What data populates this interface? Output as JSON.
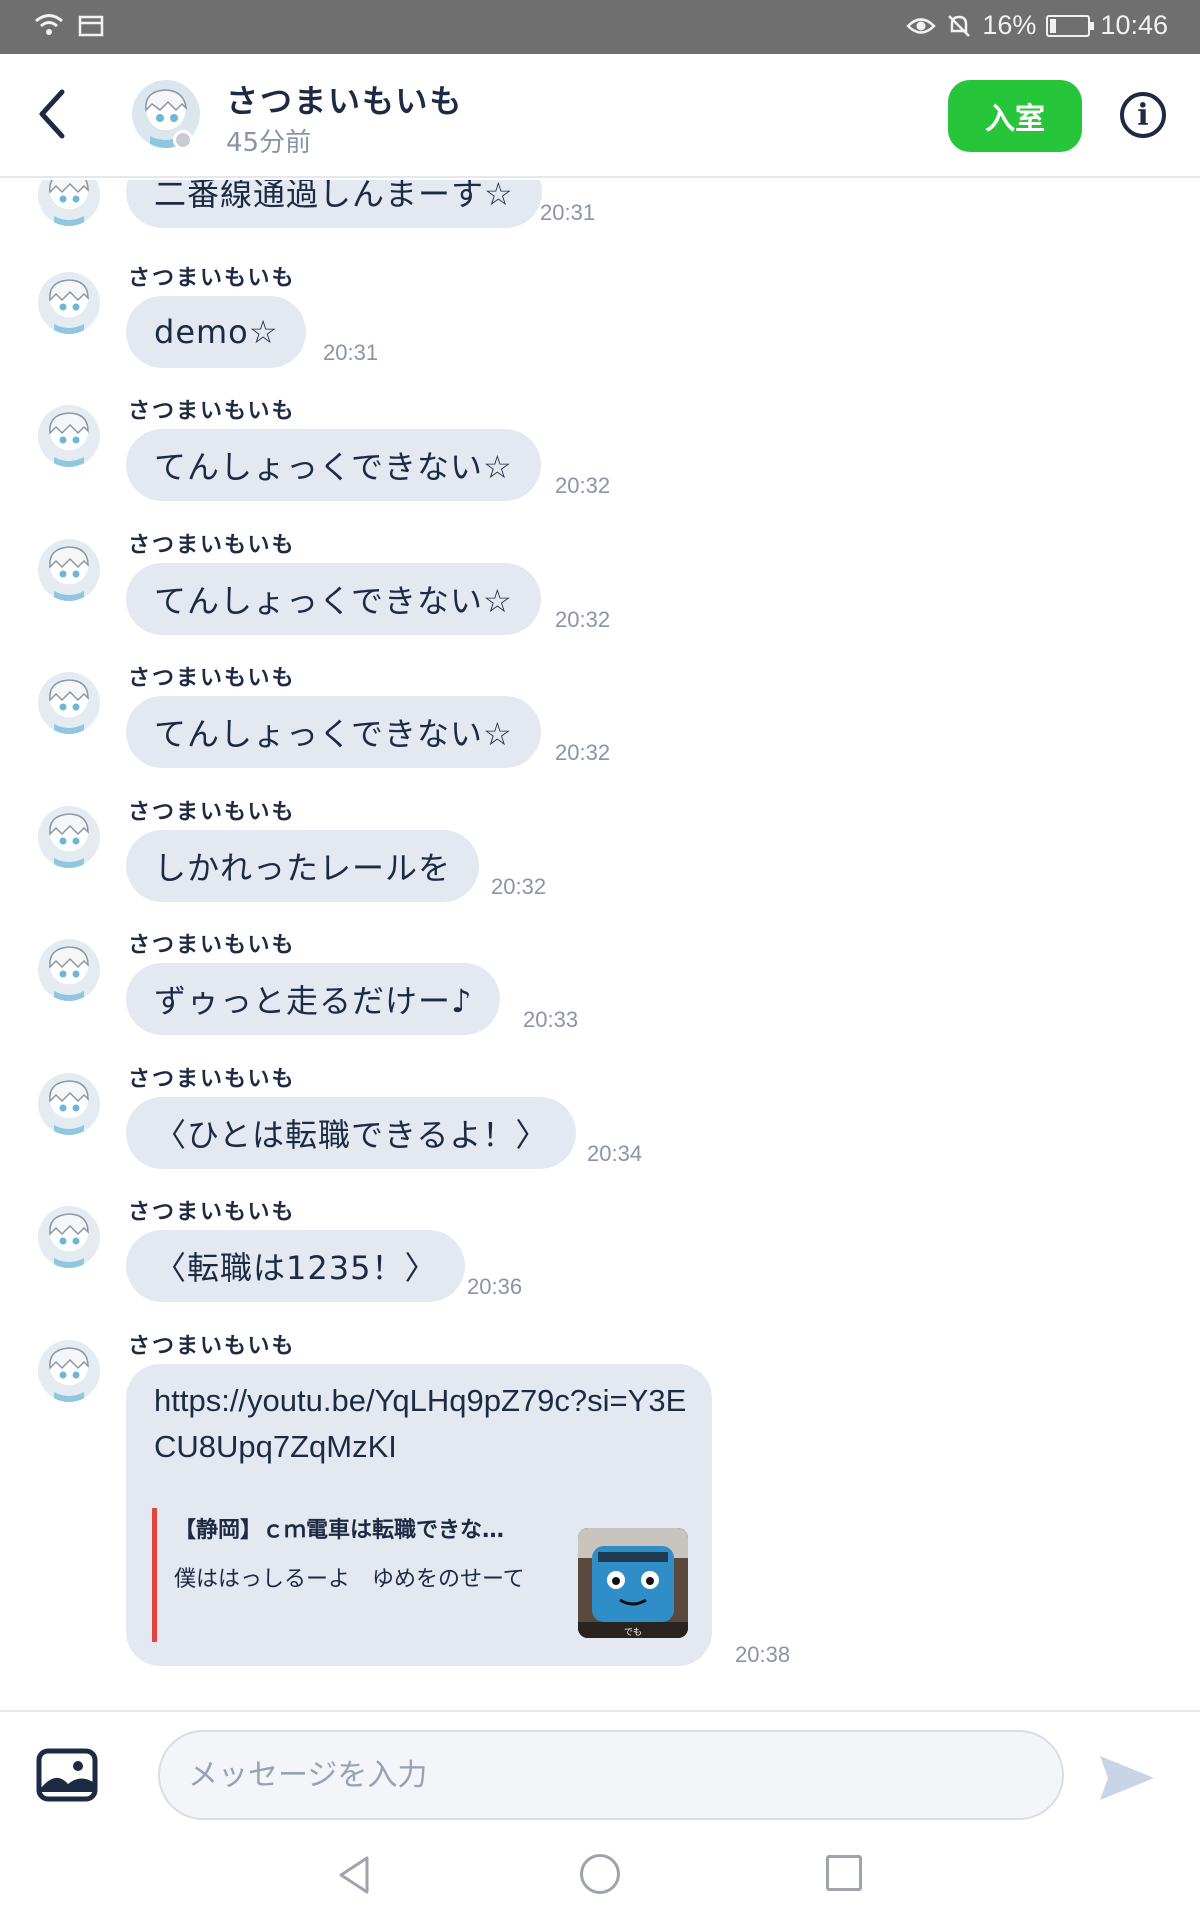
{
  "status_bar": {
    "battery": "16%",
    "battery_level": 0.16,
    "time": "10:46"
  },
  "header": {
    "back_icon": "chevron-left-icon",
    "name": "さつまいもいも",
    "last_seen": "45分前",
    "enter_label": "入室",
    "enter_color": "#27c53a",
    "info_icon": "info-icon"
  },
  "messages": [
    {
      "name": "",
      "text": "二番線通過しんまーす☆",
      "time": "20:31"
    },
    {
      "name": "さつまいもいも",
      "text": "demo☆",
      "time": "20:31"
    },
    {
      "name": "さつまいもいも",
      "text": "てんしょっくできない☆",
      "time": "20:32"
    },
    {
      "name": "さつまいもいも",
      "text": "てんしょっくできない☆",
      "time": "20:32"
    },
    {
      "name": "さつまいもいも",
      "text": "てんしょっくできない☆",
      "time": "20:32"
    },
    {
      "name": "さつまいもいも",
      "text": "しかれったレールを",
      "time": "20:32"
    },
    {
      "name": "さつまいもいも",
      "text": "ずゥっと走るだけー♪",
      "time": "20:33"
    },
    {
      "name": "さつまいもいも",
      "text": "〈ひとは転職できるよ！〉",
      "time": "20:34"
    },
    {
      "name": "さつまいもいも",
      "text": "〈転職は1235！〉",
      "time": "20:36"
    }
  ],
  "link_message": {
    "name": "さつまいもいも",
    "url": "https://youtu.be/YqLHq9pZ79c?si=Y3ECU8Upq7ZqMzKI",
    "preview_title": "【静岡】ｃｍ電車は転職できな…",
    "preview_description": "僕ははっしるーよ　ゆめをのせーて",
    "thumb_caption": "でも",
    "accent_color": "#e0463c",
    "time": "20:38"
  },
  "input": {
    "placeholder": "メッセージを入力",
    "value": "",
    "image_icon": "image-icon",
    "send_icon": "send-icon"
  },
  "nav": {
    "back_icon": "nav-back-icon",
    "home_icon": "nav-home-icon",
    "recent_icon": "nav-recent-icon"
  },
  "colors": {
    "bubble": "#e4e8f0",
    "text": "#1d2a44",
    "time": "#8a94a6"
  }
}
